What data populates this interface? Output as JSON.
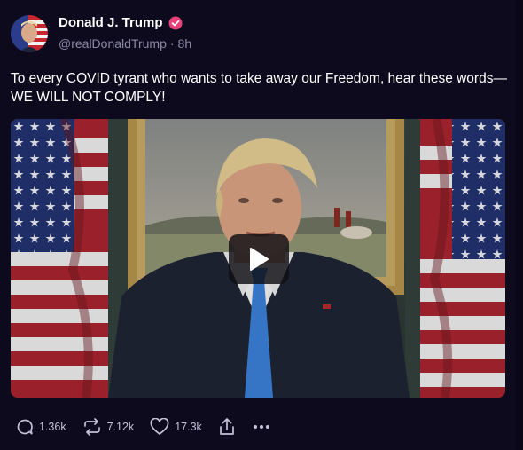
{
  "post": {
    "author": {
      "name": "Donald J. Trump",
      "handle": "@realDonaldTrump",
      "separator": "·",
      "time_ago": "8h",
      "verified": true
    },
    "text": "To every COVID tyrant who wants to take away our Freedom, hear these words—WE WILL NOT COMPLY!",
    "media": {
      "type": "video",
      "play_icon": "play-icon"
    }
  },
  "actions": {
    "replies": {
      "count": "1.36k",
      "icon": "reply-icon"
    },
    "reposts": {
      "count": "7.12k",
      "icon": "repost-icon"
    },
    "likes": {
      "count": "17.3k",
      "icon": "heart-icon"
    },
    "share": {
      "icon": "share-icon"
    },
    "more": {
      "icon": "more-icon"
    }
  },
  "colors": {
    "background": "#0c0a1c",
    "verified_badge": "#e8417a",
    "muted_text": "#8d8aa6",
    "action_text": "#c4c2d6"
  }
}
